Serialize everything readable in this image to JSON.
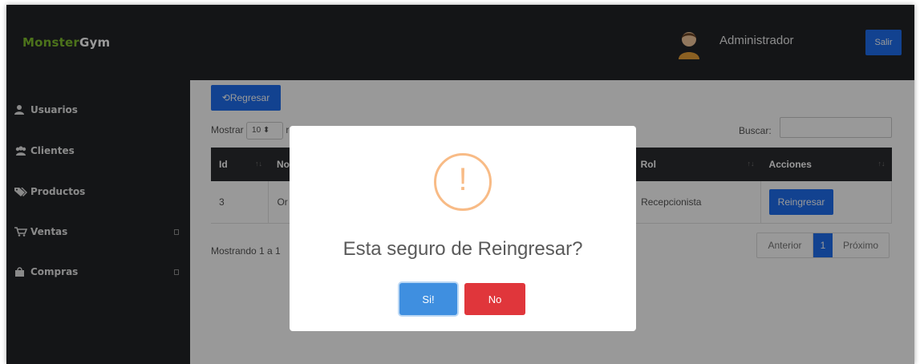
{
  "header": {
    "brand_part1": "Monster",
    "brand_part2": "Gym",
    "user_name": "Administrador",
    "logout_label": "Salir",
    "avatar_icon": "user-avatar-icon"
  },
  "sidebar": {
    "items": [
      {
        "label": "Usuarios",
        "icon": "user-icon"
      },
      {
        "label": "Clientes",
        "icon": "users-icon"
      },
      {
        "label": "Productos",
        "icon": "tags-icon"
      },
      {
        "label": "Ventas",
        "icon": "cart-icon"
      },
      {
        "label": "Compras",
        "icon": "bag-icon"
      }
    ]
  },
  "main": {
    "back_label": "Regresar",
    "show_prefix": "Mostrar",
    "page_size": "10",
    "show_suffix": "registros",
    "search_label": "Buscar:",
    "search_value": "",
    "table": {
      "columns": [
        "Id",
        "No",
        "Rol",
        "Acciones"
      ],
      "rows": [
        {
          "id": "3",
          "name": "Or",
          "rol": "Recepcionista",
          "action": "Reingresar"
        }
      ]
    },
    "info_text": "Mostrando 1 a 1",
    "pagination": {
      "prev": "Anterior",
      "current": "1",
      "next": "Próximo"
    }
  },
  "modal": {
    "icon": "warning-icon",
    "symbol": "!",
    "message": "Esta seguro de Reingresar?",
    "confirm_label": "Si!",
    "cancel_label": "No"
  },
  "colors": {
    "primary": "#1f6ff0",
    "danger": "#e0363b",
    "warning": "#f8bb86",
    "brand_green": "#7fbf2e",
    "dark": "#222327"
  }
}
